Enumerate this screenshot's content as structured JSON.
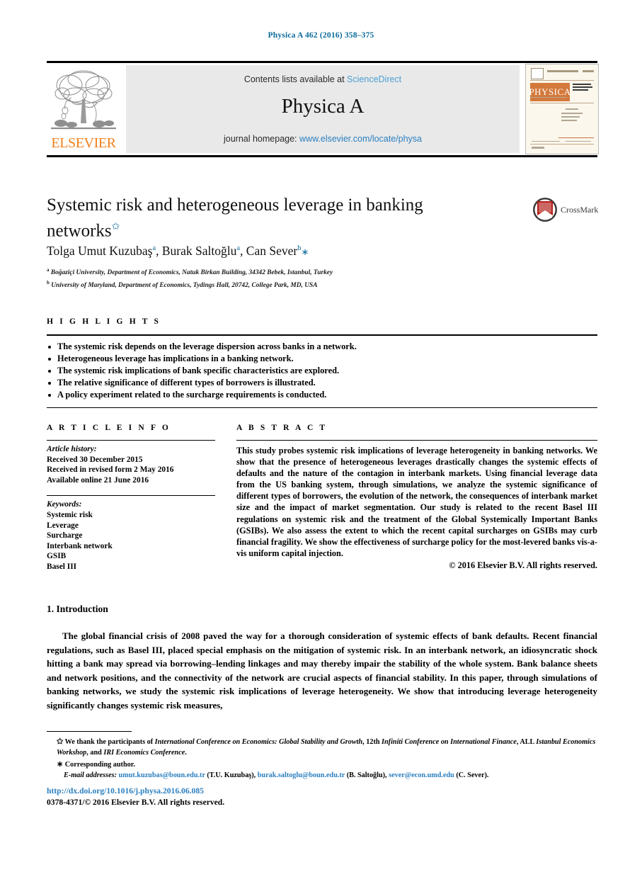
{
  "running_head": "Physica A 462 (2016) 358–375",
  "masthead": {
    "contents_prefix": "Contents lists available at ",
    "sciencedirect": "ScienceDirect",
    "journal_name": "Physica A",
    "homepage_prefix": "journal homepage: ",
    "homepage_url": "www.elsevier.com/locate/physa",
    "publisher": "ELSEVIER",
    "cover_title": "PHYSICA",
    "logo_icon": "elsevier-tree-icon"
  },
  "article": {
    "title": "Systemic risk and heterogeneous leverage in banking networks",
    "title_footnote_mark": "✩",
    "crossmark_label": "CrossMark",
    "authors_html": "Tolga Umut Kuzubaş<sup>a</sup>, Burak Saltoğlu<sup>a</sup>, Can Sever<sup>b</sup><span class=\"ast\">∗</span>",
    "affiliations": [
      {
        "mark": "a",
        "text": "Boğaziçi University, Department of Economics, Natuk Birkan Building, 34342 Bebek, Istanbul, Turkey"
      },
      {
        "mark": "b",
        "text": "University of Maryland, Department of Economics, Tydings Hall, 20742, College Park, MD, USA"
      }
    ]
  },
  "highlights": {
    "heading": "H I G H L I G H T S",
    "items": [
      "The systemic risk depends on the leverage dispersion across banks in a network.",
      "Heterogeneous leverage has implications in a banking network.",
      "The systemic risk implications of bank specific characteristics are explored.",
      "The relative significance of different types of borrowers is illustrated.",
      "A policy experiment related to the surcharge requirements is conducted."
    ]
  },
  "article_info": {
    "heading": "A R T I C L E    I N F O",
    "history_label": "Article history:",
    "history": [
      "Received 30 December 2015",
      "Received in revised form 2 May 2016",
      "Available online 21 June 2016"
    ],
    "keywords_label": "Keywords:",
    "keywords": [
      "Systemic risk",
      "Leverage",
      "Surcharge",
      "Interbank network",
      "GSIB",
      "Basel III"
    ]
  },
  "abstract": {
    "heading": "A B S T R A C T",
    "text": "This study probes systemic risk implications of leverage heterogeneity in banking networks. We show that the presence of heterogeneous leverages drastically changes the systemic effects of defaults and the nature of the contagion in interbank markets. Using financial leverage data from the US banking system, through simulations, we analyze the systemic significance of different types of borrowers, the evolution of the network, the consequences of interbank market size and the impact of market segmentation. Our study is related to the recent Basel III regulations on systemic risk and the treatment of the Global Systemically Important Banks (GSIBs). We also assess the extent to which the recent capital surcharges on GSIBs may curb financial fragility. We show the effectiveness of surcharge policy for the most-levered banks vis-a-vis uniform capital injection.",
    "copyright": "© 2016 Elsevier B.V. All rights reserved."
  },
  "introduction": {
    "heading": "1. Introduction",
    "paragraph": "The global financial crisis of 2008 paved the way for a thorough consideration of systemic effects of bank defaults. Recent financial regulations, such as Basel III, placed special emphasis on the mitigation of systemic risk. In an interbank network, an idiosyncratic shock hitting a bank may spread via borrowing–lending linkages and may thereby impair the stability of the whole system. Bank balance sheets and network positions, and the connectivity of the network are crucial aspects of financial stability. In this paper, through simulations of banking networks, we study the systemic risk implications of leverage heterogeneity. We show that introducing leverage heterogeneity significantly changes systemic risk measures,"
  },
  "footnotes": {
    "acknowledgement_mark": "✩",
    "acknowledgement_pre": " We thank the participants of ",
    "acknowledgement_it1": "International Conference on Economics: Global Stability and Growth",
    "acknowledgement_mid1": ", 12th ",
    "acknowledgement_it2": "Infiniti Conference on International Finance",
    "acknowledgement_mid2": ", ALL ",
    "acknowledgement_it3": "Istanbul Economics Workshop",
    "acknowledgement_mid3": ", and ",
    "acknowledgement_it4": "IRI Economics Conference",
    "acknowledgement_end": ".",
    "corresponding_mark": "∗",
    "corresponding_text": " Corresponding author.",
    "email_label": "E-mail addresses:",
    "emails": [
      {
        "address": "umut.kuzubas@boun.edu.tr",
        "owner": "(T.U. Kuzubaş)"
      },
      {
        "address": "burak.saltoglu@boun.edu.tr",
        "owner": "(B. Saltoğlu)"
      },
      {
        "address": "sever@econ.umd.edu",
        "owner": "(C. Sever)"
      }
    ],
    "doi": "http://dx.doi.org/10.1016/j.physa.2016.06.085",
    "issn": "0378-4371/© 2016 Elsevier B.V. All rights reserved."
  },
  "colors": {
    "header_blue": "#0b6a9a",
    "link_blue": "#2a7fc0",
    "sciencedirect_blue": "#4a9fd4",
    "elsevier_orange": "#f07f1a",
    "crossmark_red": "#b5201a"
  }
}
